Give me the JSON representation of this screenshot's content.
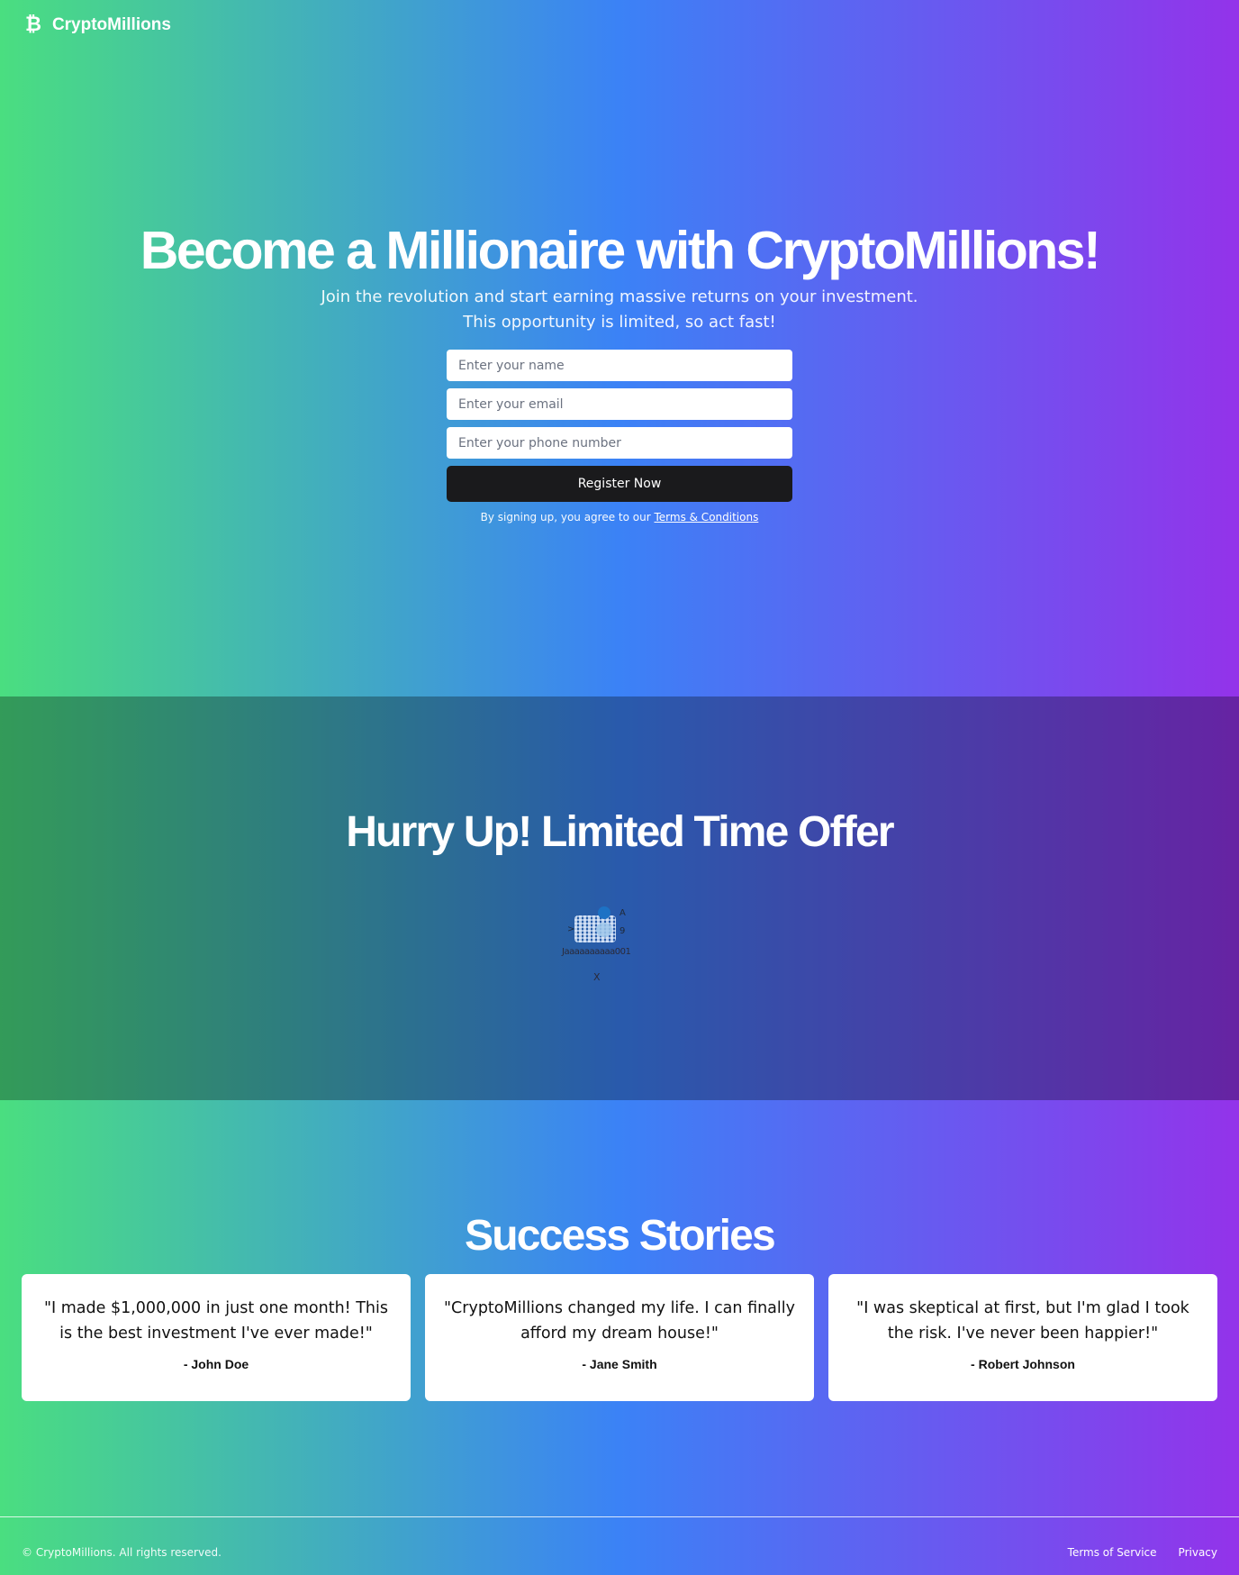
{
  "header": {
    "logo_icon": "₿",
    "brand": "CryptoMillions"
  },
  "hero": {
    "title": "Become a Millionaire with CryptoMillions!",
    "subtitle": "Join the revolution and start earning massive returns on your investment. This opportunity is limited, so act fast!",
    "form": {
      "name_placeholder": "Enter your name",
      "email_placeholder": "Enter your email",
      "phone_placeholder": "Enter your phone number",
      "submit_label": "Register Now"
    },
    "terms_prefix": "By signing up, you agree to our ",
    "terms_link": "Terms & Conditions"
  },
  "offer": {
    "title": "Hurry Up! Limited Time Offer",
    "widget_ticker": "Jaaaaaaaaaa001",
    "widget_close": "X"
  },
  "stories": {
    "title": "Success Stories",
    "items": [
      {
        "quote": "\"I made $1,000,000 in just one month! This is the best investment I've ever made!\"",
        "author": "- John Doe"
      },
      {
        "quote": "\"CryptoMillions changed my life. I can finally afford my dream house!\"",
        "author": "- Jane Smith"
      },
      {
        "quote": "\"I was skeptical at first, but I'm glad I took the risk. I've never been happier!\"",
        "author": "- Robert Johnson"
      }
    ]
  },
  "footer": {
    "copyright": "© CryptoMillions. All rights reserved.",
    "links": [
      "Terms of Service",
      "Privacy"
    ]
  },
  "colors": {
    "gradient_start": "#4ade80",
    "gradient_mid": "#3b82f6",
    "gradient_end": "#9333ea",
    "button_bg": "#1a1a1c"
  }
}
